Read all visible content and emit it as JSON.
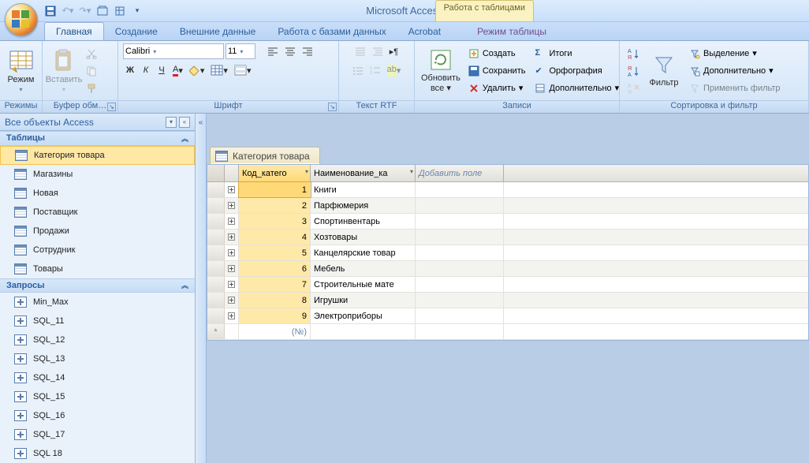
{
  "app_title": "Microsoft Access",
  "context_tool": "Работа с таблицами",
  "tabs": {
    "home": "Главная",
    "create": "Создание",
    "external": "Внешние данные",
    "dbtools": "Работа с базами данных",
    "acrobat": "Acrobat",
    "datasheet": "Режим таблицы"
  },
  "ribbon": {
    "views": {
      "btn": "Режим",
      "label": "Режимы"
    },
    "clipboard": {
      "paste": "Вставить",
      "label": "Буфер обм…"
    },
    "font": {
      "family": "Calibri",
      "size": "11",
      "label": "Шрифт"
    },
    "richtext": {
      "label": "Текст RTF"
    },
    "records": {
      "refresh": "Обновить",
      "refresh2": "все",
      "new": "Создать",
      "save": "Сохранить",
      "delete": "Удалить",
      "totals": "Итоги",
      "spelling": "Орфография",
      "more": "Дополнительно",
      "label": "Записи"
    },
    "filter": {
      "filter": "Фильтр",
      "selection": "Выделение",
      "advanced": "Дополнительно",
      "toggle": "Применить фильтр",
      "label": "Сортировка и фильтр"
    }
  },
  "nav": {
    "title": "Все объекты Access",
    "sections": {
      "tables": "Таблицы",
      "queries": "Запросы"
    },
    "tables": [
      "Категория товара",
      "Магазины",
      "Новая",
      "Поставщик",
      "Продажи",
      "Сотрудник",
      "Товары"
    ],
    "queries": [
      "Min_Max",
      "SQL_11",
      "SQL_12",
      "SQL_13",
      "SQL_14",
      "SQL_15",
      "SQL_16",
      "SQL_17",
      "SQL 18"
    ]
  },
  "datasheet": {
    "tab_title": "Категория товара",
    "columns": {
      "c1": "Код_катего",
      "c2": "Наименование_ка",
      "add": "Добавить поле"
    },
    "new_placeholder": "(№)",
    "rows": [
      {
        "id": "1",
        "name": "Книги"
      },
      {
        "id": "2",
        "name": "Парфюмерия"
      },
      {
        "id": "3",
        "name": "Спортинвентарь"
      },
      {
        "id": "4",
        "name": "Хозтовары"
      },
      {
        "id": "5",
        "name": "Канцелярские товар"
      },
      {
        "id": "6",
        "name": "Мебель"
      },
      {
        "id": "7",
        "name": "Строительные мате"
      },
      {
        "id": "8",
        "name": "Игрушки"
      },
      {
        "id": "9",
        "name": "Электроприборы"
      }
    ]
  }
}
